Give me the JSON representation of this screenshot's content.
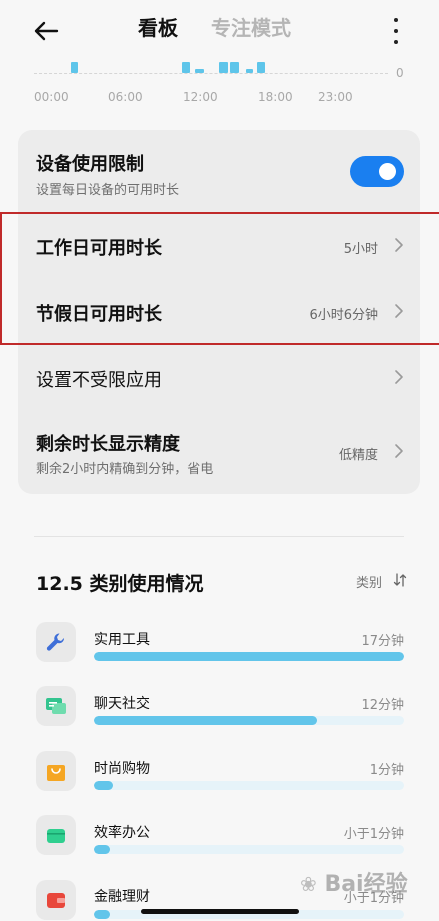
{
  "header": {
    "tab_active": "看板",
    "tab_inactive": "专注模式"
  },
  "usage_chart": {
    "zero_label": "0",
    "x_ticks": [
      "00:00",
      "06:00",
      "12:00",
      "18:00",
      "23:00"
    ]
  },
  "settings": {
    "device_limit": {
      "title": "设备使用限制",
      "subtitle": "设置每日设备的可用时长",
      "enabled": true
    },
    "workday": {
      "title": "工作日可用时长",
      "value": "5小时"
    },
    "holiday": {
      "title": "节假日可用时长",
      "value": "6小时6分钟"
    },
    "unlimited_apps": {
      "title": "设置不受限应用"
    },
    "precision": {
      "title": "剩余时长显示精度",
      "subtitle": "剩余2小时内精确到分钟，省电",
      "value": "低精度"
    }
  },
  "categories": {
    "title": "12.5 类别使用情况",
    "sort_label": "类别",
    "items": [
      {
        "name": "实用工具",
        "time": "17分钟",
        "fraction": 1.0,
        "icon": "wrench-icon",
        "color": "#3f6fd8"
      },
      {
        "name": "聊天社交",
        "time": "12分钟",
        "fraction": 0.72,
        "icon": "chat-icon",
        "color": "#33c48f"
      },
      {
        "name": "时尚购物",
        "time": "1分钟",
        "fraction": 0.06,
        "icon": "shopping-bag-icon",
        "color": "#f5a623"
      },
      {
        "name": "效率办公",
        "time": "小于1分钟",
        "fraction": 0.05,
        "icon": "briefcase-icon",
        "color": "#2fcf8f"
      },
      {
        "name": "金融理财",
        "time": "小于1分钟",
        "fraction": 0.05,
        "icon": "wallet-icon",
        "color": "#e8473b"
      }
    ]
  },
  "watermark": "Bai经验"
}
